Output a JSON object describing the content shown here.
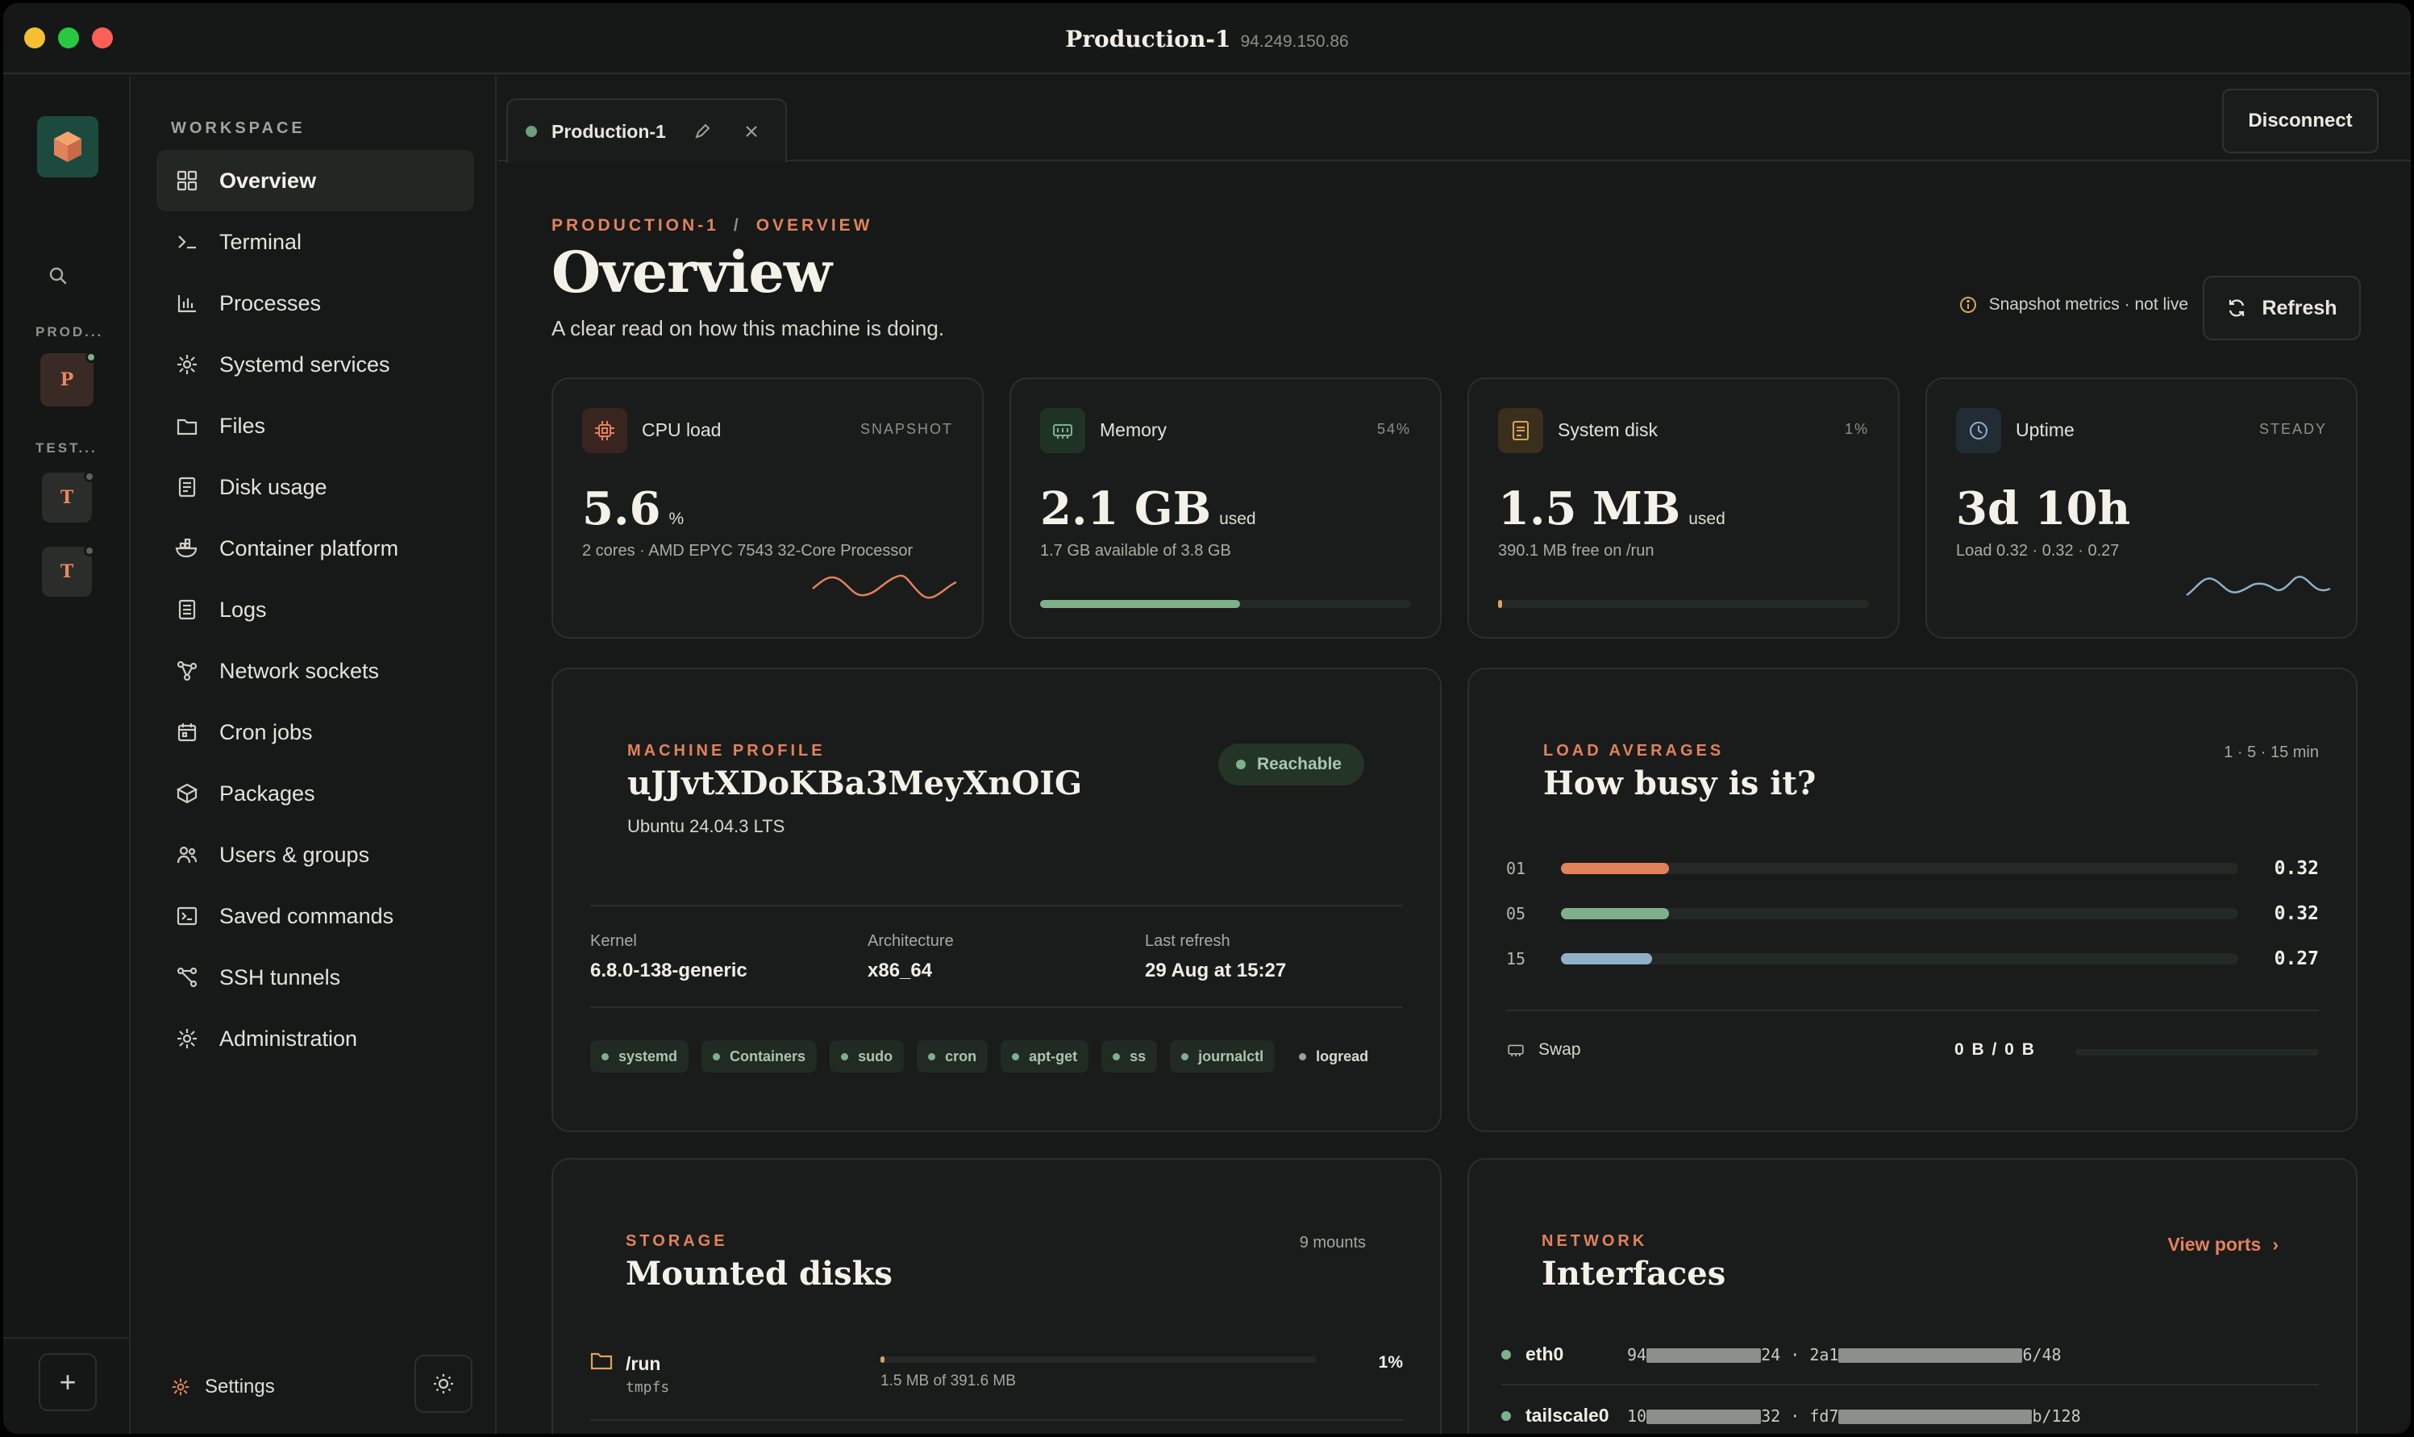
{
  "window": {
    "title": "Production-1",
    "ip": "94.249.150.86",
    "traffic_colors": [
      "#f5bf2f",
      "#28c840",
      "#fe5f57"
    ]
  },
  "rail": {
    "groups": [
      {
        "label": "PROD...",
        "hosts": [
          {
            "initial": "P",
            "status": "online"
          }
        ]
      },
      {
        "label": "TEST...",
        "hosts": [
          {
            "initial": "T",
            "status": "idle"
          },
          {
            "initial": "T",
            "status": "idle"
          }
        ]
      }
    ],
    "add_label": "+"
  },
  "sidebar": {
    "workspace_label": "WORKSPACE",
    "items": [
      {
        "label": "Overview",
        "icon": "grid-icon",
        "active": true
      },
      {
        "label": "Terminal",
        "icon": "terminal-icon"
      },
      {
        "label": "Processes",
        "icon": "bar-chart-icon"
      },
      {
        "label": "Systemd services",
        "icon": "sparkle-icon"
      },
      {
        "label": "Files",
        "icon": "folder-icon"
      },
      {
        "label": "Disk usage",
        "icon": "document-icon"
      },
      {
        "label": "Container platform",
        "icon": "whale-icon"
      },
      {
        "label": "Logs",
        "icon": "list-icon"
      },
      {
        "label": "Network sockets",
        "icon": "network-icon"
      },
      {
        "label": "Cron jobs",
        "icon": "calendar-icon"
      },
      {
        "label": "Packages",
        "icon": "package-icon"
      },
      {
        "label": "Users & groups",
        "icon": "users-icon"
      },
      {
        "label": "Saved commands",
        "icon": "console-icon"
      },
      {
        "label": "SSH tunnels",
        "icon": "tunnel-icon"
      },
      {
        "label": "Administration",
        "icon": "gear-icon"
      }
    ],
    "settings_label": "Settings"
  },
  "tabs": [
    {
      "label": "Production-1"
    }
  ],
  "disconnect_label": "Disconnect",
  "header": {
    "crumb_host": "PRODUCTION-1",
    "crumb_sep": "/",
    "crumb_page": "OVERVIEW",
    "title": "Overview",
    "subtitle": "A clear read on how this machine is doing.",
    "snapshot_note": "Snapshot metrics · not live",
    "refresh_label": "Refresh"
  },
  "stats": [
    {
      "label": "CPU load",
      "tag": "SNAPSHOT",
      "value": "5.6",
      "unit": "%",
      "detail": "2 cores · AMD EPYC 7543 32-Core Processor",
      "icon": "cpu-icon",
      "accent": "#e2825d"
    },
    {
      "label": "Memory",
      "tag": "54%",
      "value": "2.1 GB",
      "unit": "used",
      "detail": "1.7 GB available of 3.8 GB",
      "icon": "memory-icon",
      "accent": "#7fb08a",
      "fill_fraction": 0.54
    },
    {
      "label": "System disk",
      "tag": "1%",
      "value": "1.5 MB",
      "unit": "used",
      "detail": "390.1 MB free on /run",
      "icon": "disk-icon",
      "accent": "#d9a55a",
      "fill_fraction": 0.01
    },
    {
      "label": "Uptime",
      "tag": "STEADY",
      "value": "3d 10h",
      "unit": "",
      "detail": "Load 0.32 · 0.32 · 0.27",
      "icon": "clock-icon",
      "accent": "#8fb0c8"
    }
  ],
  "profile": {
    "section": "MACHINE PROFILE",
    "hostname": "uJJvtXDoKBa3MeyXnOIG",
    "os": "Ubuntu 24.04.3 LTS",
    "status": "Reachable",
    "kernel_label": "Kernel",
    "kernel": "6.8.0-138-generic",
    "arch_label": "Architecture",
    "arch": "x86_64",
    "refresh_label": "Last refresh",
    "refresh": "29 Aug at 15:27",
    "capabilities": [
      "systemd",
      "Containers",
      "sudo",
      "cron",
      "apt-get",
      "ss",
      "journalctl",
      "logread"
    ]
  },
  "load": {
    "section": "LOAD AVERAGES",
    "title": "How busy is it?",
    "window": "1 · 5 · 15 min",
    "rows": [
      {
        "key": "01",
        "value": "0.32",
        "color": "#e2825d",
        "fraction": 0.16
      },
      {
        "key": "05",
        "value": "0.32",
        "color": "#7fb08a",
        "fraction": 0.16
      },
      {
        "key": "15",
        "value": "0.27",
        "color": "#8fb0c8",
        "fraction": 0.135
      }
    ],
    "swap_label": "Swap",
    "swap_value": "0 B / 0 B"
  },
  "storage": {
    "section": "STORAGE",
    "title": "Mounted disks",
    "count": "9 mounts",
    "mounts": [
      {
        "path": "/run",
        "fs": "tmpfs",
        "detail": "1.5 MB of 391.6 MB",
        "pct": "1%",
        "fraction": 0.01
      }
    ]
  },
  "network": {
    "section": "NETWORK",
    "title": "Interfaces",
    "link": "View ports",
    "interfaces": [
      {
        "name": "eth0",
        "v4_start": "94",
        "v4_end": "24",
        "sep": " · ",
        "v6_start": "2a1",
        "v6_end": "6/48"
      },
      {
        "name": "tailscale0",
        "v4_start": "10",
        "v4_end": "32",
        "sep": " · ",
        "v6_start": "fd7",
        "v6_end": "b/128"
      }
    ]
  }
}
